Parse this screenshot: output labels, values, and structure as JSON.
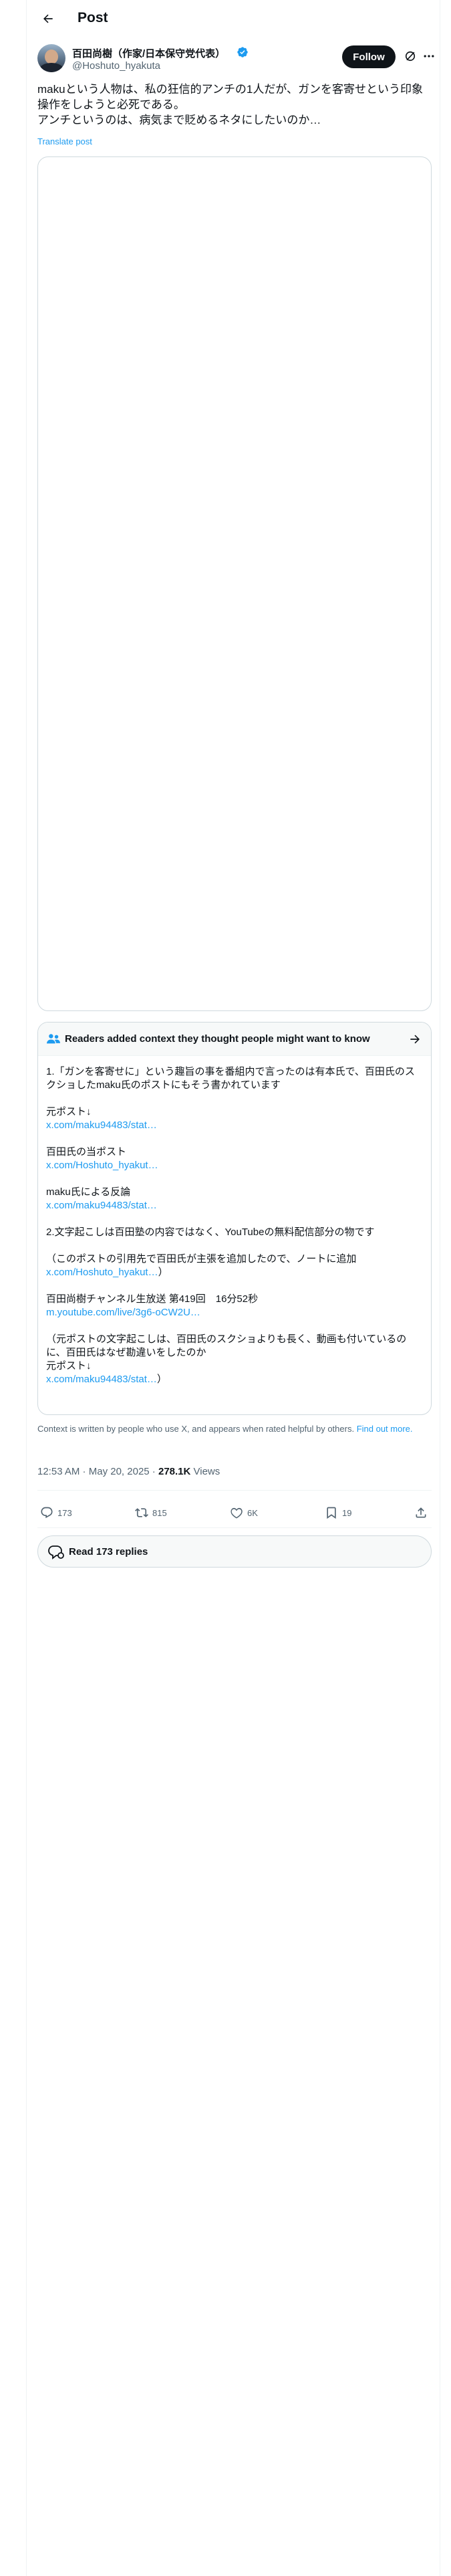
{
  "header": {
    "title": "Post"
  },
  "author": {
    "name": "百田尚樹（作家/日本保守党代表）",
    "handle": "@Hoshuto_hyakuta",
    "follow_label": "Follow"
  },
  "tweet": {
    "lines": [
      "makuという人物は、私の狂信的アンチの1人だが、ガンを客寄せという印象操作をしようと必死である。",
      "アンチというのは、病気まで貶めるネタにしたいのか…"
    ],
    "translate_label": "Translate post"
  },
  "community_note": {
    "title": "Readers added context they thought people might want to know",
    "body": [
      {
        "type": "text",
        "value": "1.「ガンを客寄せに」という趣旨の事を番組内で言ったのは有本氏で、百田氏のスクショしたmaku氏のポストにもそう書かれています"
      },
      {
        "type": "gap"
      },
      {
        "type": "text",
        "value": "元ポスト↓"
      },
      {
        "type": "link",
        "value": "x.com/maku94483/stat…"
      },
      {
        "type": "gap"
      },
      {
        "type": "text",
        "value": "百田氏の当ポスト"
      },
      {
        "type": "link",
        "value": "x.com/Hoshuto_hyakut…"
      },
      {
        "type": "gap"
      },
      {
        "type": "text",
        "value": "maku氏による反論"
      },
      {
        "type": "link",
        "value": "x.com/maku94483/stat…"
      },
      {
        "type": "gap"
      },
      {
        "type": "text",
        "value": "2.文字起こしは百田塾の内容ではなく、YouTubeの無料配信部分の物です"
      },
      {
        "type": "gap"
      },
      {
        "type": "text",
        "value": "（このポストの引用先で百田氏が主張を追加したので、ノートに追加"
      },
      {
        "type": "link",
        "value": "x.com/Hoshuto_hyakut…",
        "suffix": "）"
      },
      {
        "type": "gap"
      },
      {
        "type": "text",
        "value": "百田尚樹チャンネル生放送 第419回　16分52秒"
      },
      {
        "type": "link",
        "value": "m.youtube.com/live/3g6-oCW2U…"
      },
      {
        "type": "gap"
      },
      {
        "type": "text",
        "value": "（元ポストの文字起こしは、百田氏のスクショよりも長く、動画も付いているのに、百田氏はなぜ勘違いをしたのか"
      },
      {
        "type": "text",
        "value": "元ポスト↓"
      },
      {
        "type": "link",
        "value": "x.com/maku94483/stat…",
        "suffix": "）"
      }
    ],
    "footer_text": "Context is written by people who use X, and appears when rated helpful by others.",
    "footer_link": "Find out more."
  },
  "meta": {
    "time": "12:53 AM",
    "separator": " · ",
    "date": "May 20, 2025",
    "views_count": "278.1K",
    "views_label": " Views"
  },
  "actions": {
    "replies": "173",
    "reposts": "815",
    "likes": "6K",
    "bookmarks": "19"
  },
  "read_replies": {
    "label": "Read 173 replies"
  },
  "colors": {
    "accent": "#1d9bf0",
    "text": "#0f1419",
    "muted": "#536471",
    "border": "#cfd9de"
  }
}
